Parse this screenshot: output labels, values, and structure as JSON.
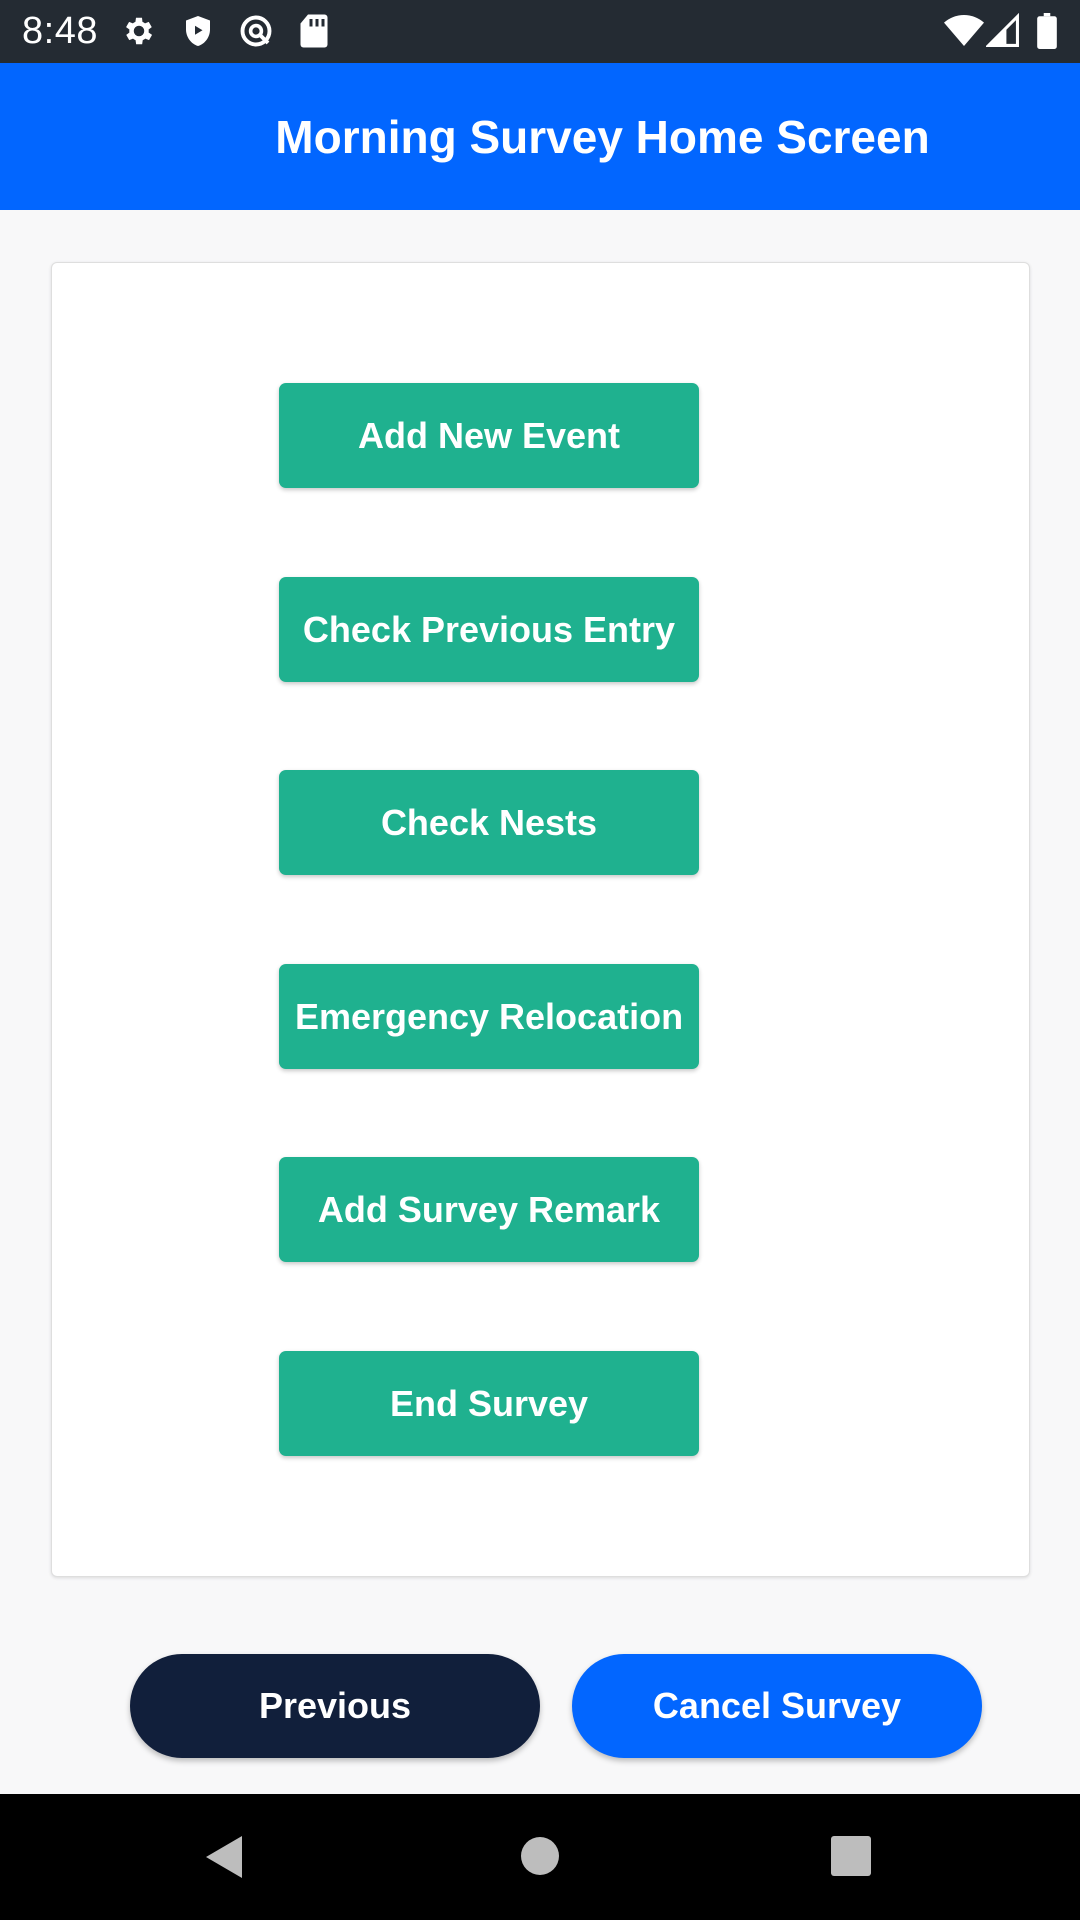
{
  "status_bar": {
    "time": "8:48",
    "icons": [
      "gear-icon",
      "shield-icon",
      "at-sign-icon",
      "sd-card-icon",
      "wifi-icon",
      "signal-icon",
      "battery-icon"
    ]
  },
  "header": {
    "title": "Morning Survey Home Screen"
  },
  "menu": {
    "buttons": [
      {
        "label": "Add New Event"
      },
      {
        "label": "Check Previous Entry"
      },
      {
        "label": "Check Nests"
      },
      {
        "label": "Emergency Relocation"
      },
      {
        "label": "Add Survey Remark"
      },
      {
        "label": "End Survey"
      }
    ]
  },
  "footer": {
    "previous_label": "Previous",
    "cancel_label": "Cancel Survey"
  },
  "nav_bar": {
    "icons": [
      "back-icon",
      "home-icon",
      "recents-icon"
    ]
  },
  "colors": {
    "status_bar": "#242b33",
    "app_bar": "#0266ff",
    "menu_button": "#1fb18f",
    "previous_button": "#111f3b",
    "cancel_button": "#0266ff",
    "background": "#f8f8f9"
  }
}
